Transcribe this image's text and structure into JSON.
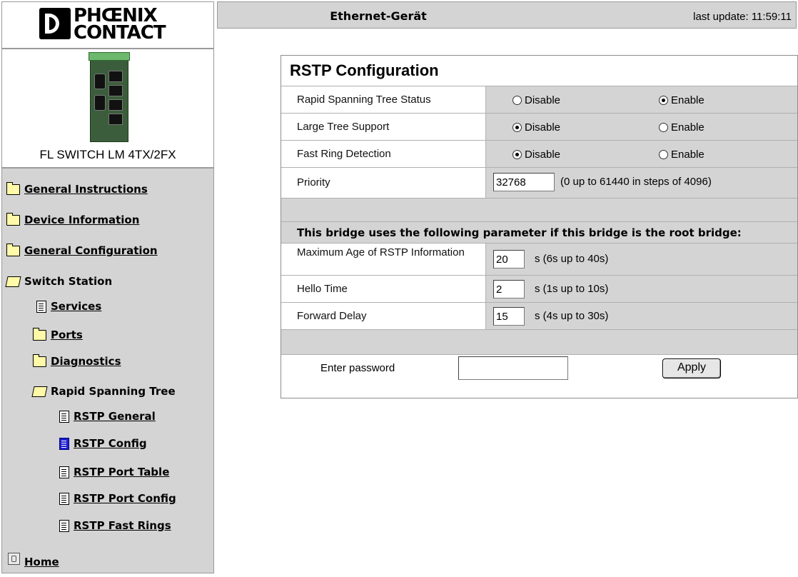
{
  "brand": {
    "line1": "PHŒNIX",
    "line2": "CONTACT"
  },
  "device": {
    "name": "FL SWITCH LM 4TX/2FX"
  },
  "header": {
    "title": "Ethernet-Gerät",
    "last_update": "last update: 11:59:11"
  },
  "nav": {
    "general_instructions": "General Instructions",
    "device_information": "Device Information",
    "general_configuration": "General Configuration",
    "switch_station": "Switch Station",
    "services": "Services",
    "ports": "Ports",
    "diagnostics": "Diagnostics",
    "rapid_spanning_tree": "Rapid Spanning Tree",
    "rstp_general": "RSTP General",
    "rstp_config": "RSTP Config",
    "rstp_port_table": "RSTP Port Table",
    "rstp_port_config": "RSTP Port Config",
    "rstp_fast_rings": "RSTP Fast Rings",
    "home": "Home"
  },
  "form": {
    "caption": "RSTP Configuration",
    "disable": "Disable",
    "enable": "Enable",
    "rows": {
      "rstp_status": {
        "label": "Rapid Spanning Tree Status",
        "selected": "Enable"
      },
      "large_tree": {
        "label": "Large Tree Support",
        "selected": "Disable"
      },
      "fast_ring": {
        "label": "Fast Ring Detection",
        "selected": "Disable"
      },
      "priority": {
        "label": "Priority",
        "value": "32768",
        "hint": "(0 up to 61440 in steps of 4096)"
      }
    },
    "root_bridge_text": "This bridge uses the following parameter if this bridge is the root bridge:",
    "max_age": {
      "label": "Maximum Age of RSTP Information",
      "value": "20",
      "hint": "s (6s up to 40s)"
    },
    "hello_time": {
      "label": "Hello Time",
      "value": "2",
      "hint": "s (1s up to 10s)"
    },
    "forward_delay": {
      "label": "Forward Delay",
      "value": "15",
      "hint": "s (4s up to 30s)"
    },
    "password_label": "Enter password",
    "password_value": "",
    "apply": "Apply"
  }
}
